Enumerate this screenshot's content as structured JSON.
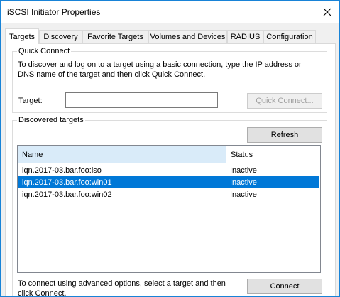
{
  "window": {
    "title": "iSCSI Initiator Properties"
  },
  "tabs": [
    {
      "label": "Targets"
    },
    {
      "label": "Discovery"
    },
    {
      "label": "Favorite Targets"
    },
    {
      "label": "Volumes and Devices"
    },
    {
      "label": "RADIUS"
    },
    {
      "label": "Configuration"
    }
  ],
  "quick_connect": {
    "title": "Quick Connect",
    "description": "To discover and log on to a target using a basic connection, type the IP address or DNS name of the target and then click Quick Connect.",
    "target_label": "Target:",
    "target_value": "",
    "button_label": "Quick Connect..."
  },
  "discovered": {
    "title": "Discovered targets",
    "refresh_label": "Refresh",
    "columns": {
      "name": "Name",
      "status": "Status"
    },
    "rows": [
      {
        "name": "iqn.2017-03.bar.foo:iso",
        "status": "Inactive"
      },
      {
        "name": "iqn.2017-03.bar.foo:win01",
        "status": "Inactive"
      },
      {
        "name": "iqn.2017-03.bar.foo:win02",
        "status": "Inactive"
      }
    ],
    "selected_row": "iqn.2017-03.bar.foo:win01",
    "footer_text": "To connect using advanced options, select a target and then click Connect.",
    "connect_label": "Connect"
  },
  "colors": {
    "window_border": "#1883d7",
    "selection": "#0078d7",
    "header_hover": "#d9ebf9"
  },
  "icons": {
    "close": "close-icon"
  }
}
